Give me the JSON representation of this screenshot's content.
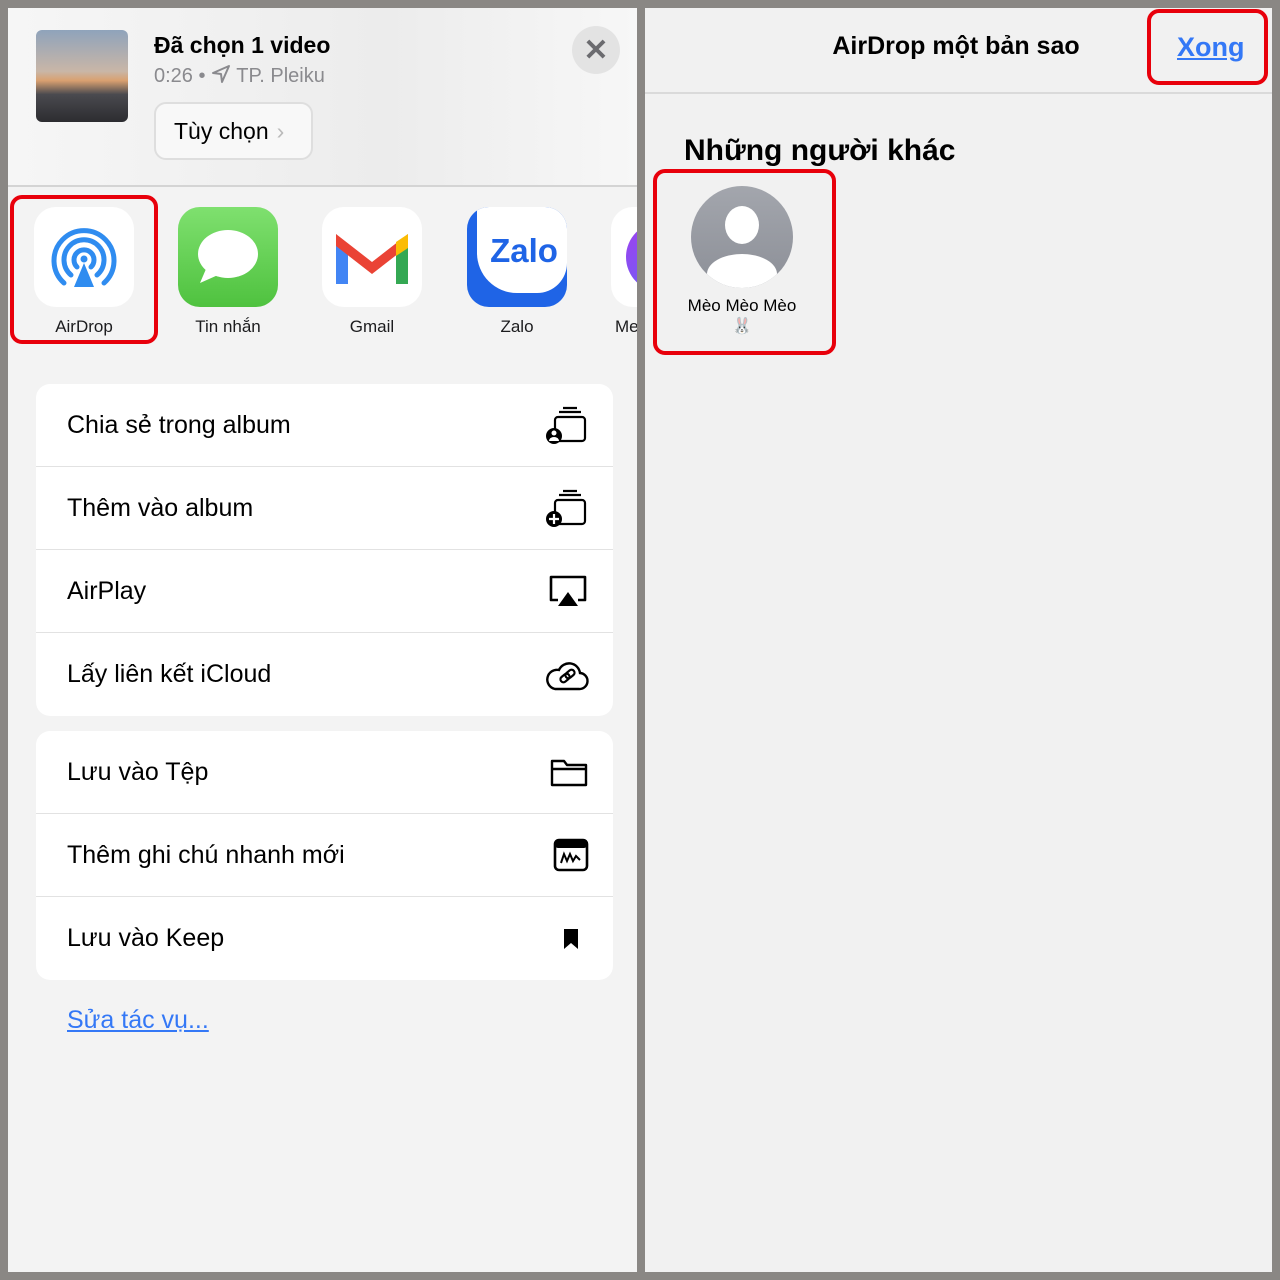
{
  "share_sheet": {
    "title": "Đã chọn 1 video",
    "duration": "0:26",
    "separator": "•",
    "location": "TP. Pleiku",
    "options_label": "Tùy chọn",
    "options_chevron": "›",
    "close_icon": "✕",
    "apps": [
      {
        "label": "AirDrop",
        "icon": "airdrop-icon",
        "highlighted": true
      },
      {
        "label": "Tin nhắn",
        "icon": "messages-icon"
      },
      {
        "label": "Gmail",
        "icon": "gmail-icon"
      },
      {
        "label": "Zalo",
        "icon": "zalo-icon",
        "icon_text": "Zalo"
      },
      {
        "label": "Me",
        "icon": "messenger-icon"
      }
    ],
    "groups": [
      [
        {
          "label": "Chia sẻ trong album",
          "icon": "shared-album-icon"
        },
        {
          "label": "Thêm vào album",
          "icon": "add-album-icon"
        },
        {
          "label": "AirPlay",
          "icon": "airplay-icon"
        },
        {
          "label": "Lấy liên kết iCloud",
          "icon": "icloud-link-icon"
        }
      ],
      [
        {
          "label": "Lưu vào Tệp",
          "icon": "folder-icon"
        },
        {
          "label": "Thêm ghi chú nhanh mới",
          "icon": "quick-note-icon"
        },
        {
          "label": "Lưu vào Keep",
          "icon": "bookmark-icon"
        }
      ]
    ],
    "edit_actions": "Sửa tác vụ..."
  },
  "airdrop": {
    "title": "AirDrop một bản sao",
    "done": "Xong",
    "section": "Những người khác",
    "person": {
      "name": "Mèo Mèo Mèo",
      "emoji": "🐰"
    }
  },
  "colors": {
    "accent": "#3478f6",
    "highlight": "#e8000b"
  }
}
